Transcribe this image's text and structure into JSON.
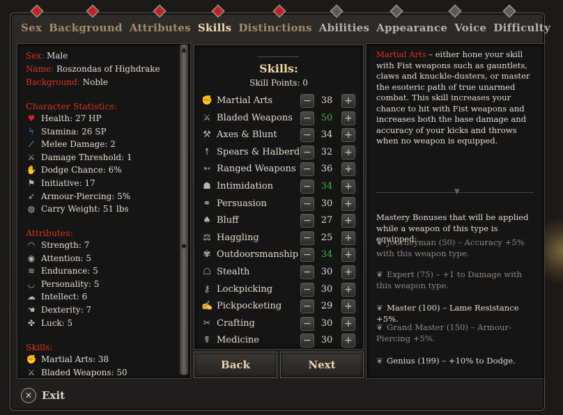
{
  "tabs": [
    {
      "label": "Sex",
      "state": "gold"
    },
    {
      "label": "Background",
      "state": "gold"
    },
    {
      "label": "Attributes",
      "state": "gold"
    },
    {
      "label": "Skills",
      "state": "active"
    },
    {
      "label": "Distinctions",
      "state": "gold"
    },
    {
      "label": "Abilities",
      "state": "grey"
    },
    {
      "label": "Appearance",
      "state": "grey"
    },
    {
      "label": "Voice",
      "state": "grey"
    },
    {
      "label": "Difficulty",
      "state": "grey"
    }
  ],
  "character": {
    "sex_label": "Sex:",
    "sex": "Male",
    "name_label": "Name:",
    "name": "Roszondas of Highdrake",
    "background_label": "Background:",
    "background": "Noble"
  },
  "statistics": {
    "heading": "Character Statistics:",
    "items": [
      {
        "icon": "heart-icon",
        "text": "Health: 27 HP"
      },
      {
        "icon": "bolt-icon",
        "text": "Stamina: 26 SP"
      },
      {
        "icon": "sword-icon",
        "text": "Melee Damage: 2"
      },
      {
        "icon": "slash-icon",
        "text": "Damage Threshold: 1"
      },
      {
        "icon": "dodge-icon",
        "text": "Dodge Chance: 6%"
      },
      {
        "icon": "flag-icon",
        "text": "Initiative: 17"
      },
      {
        "icon": "pierce-icon",
        "text": "Armour-Piercing: 5%"
      },
      {
        "icon": "weight-icon",
        "text": "Carry Weight: 51 lbs"
      }
    ]
  },
  "attributes": {
    "heading": "Attributes:",
    "items": [
      {
        "icon": "arm-icon",
        "text": "Strength: 7"
      },
      {
        "icon": "eye-icon",
        "text": "Attention: 5"
      },
      {
        "icon": "endurance-icon",
        "text": "Endurance: 5"
      },
      {
        "icon": "lips-icon",
        "text": "Personality: 5"
      },
      {
        "icon": "brain-icon",
        "text": "Intellect: 6"
      },
      {
        "icon": "hand-icon",
        "text": "Dexterity: 7"
      },
      {
        "icon": "clover-icon",
        "text": "Luck: 5"
      }
    ]
  },
  "skills_summary": {
    "heading": "Skills:",
    "items": [
      {
        "icon": "fist-icon",
        "text": "Martial Arts: 38"
      },
      {
        "icon": "blades-icon",
        "text": "Bladed Weapons: 50"
      }
    ]
  },
  "skills_panel": {
    "title": "Skills:",
    "points_label": "Skill Points: 0",
    "rows": [
      {
        "icon": "fist-icon",
        "name": "Martial Arts",
        "value": "38",
        "green": false
      },
      {
        "icon": "blades-icon",
        "name": "Bladed Weapons",
        "value": "50",
        "green": true
      },
      {
        "icon": "axe-icon",
        "name": "Axes & Blunt",
        "value": "34",
        "green": false
      },
      {
        "icon": "spear-icon",
        "name": "Spears & Halberds",
        "value": "32",
        "green": false
      },
      {
        "icon": "bow-icon",
        "name": "Ranged Weapons",
        "value": "36",
        "green": false
      },
      {
        "icon": "intimidation-icon",
        "name": "Intimidation",
        "value": "34",
        "green": true
      },
      {
        "icon": "handshake-icon",
        "name": "Persuasion",
        "value": "30",
        "green": false
      },
      {
        "icon": "bluff-icon",
        "name": "Bluff",
        "value": "27",
        "green": false
      },
      {
        "icon": "scales-icon",
        "name": "Haggling",
        "value": "25",
        "green": false
      },
      {
        "icon": "paw-icon",
        "name": "Outdoorsmanship",
        "value": "34",
        "green": true
      },
      {
        "icon": "hood-icon",
        "name": "Stealth",
        "value": "30",
        "green": false
      },
      {
        "icon": "lock-icon",
        "name": "Lockpicking",
        "value": "30",
        "green": false
      },
      {
        "icon": "pickpocket-icon",
        "name": "Pickpocketing",
        "value": "29",
        "green": false
      },
      {
        "icon": "tools-icon",
        "name": "Crafting",
        "value": "30",
        "green": false
      },
      {
        "icon": "medicine-icon",
        "name": "Medicine",
        "value": "30",
        "green": false
      }
    ],
    "minus": "−",
    "plus": "+"
  },
  "buttons": {
    "back": "Back",
    "next": "Next",
    "exit": "Exit",
    "exit_symbol": "✕"
  },
  "description": {
    "highlight": "Martial Arts",
    "text": " – either hone your skill with Fist weapons such as gauntlets, claws and knuckle-dusters, or master the esoteric path of true unarmed combat. This skill increases your chance to hit with Fist weapons and increases both the base damage and accuracy of your kicks and throws when no weapon is equipped.",
    "mastery_intro": "Mastery Bonuses that will be applied while a weapon of this type is equipped:",
    "mastery": [
      {
        "text": "Journeyman (50) – Accuracy +5% with this weapon type.",
        "dim": true
      },
      {
        "text": "Expert (75) – +1 to Damage with this weapon type.",
        "dim": true
      },
      {
        "text": "Master (100) – Lame Resistance +5%.",
        "dim": false
      },
      {
        "text": "Grand Master (150) – Armour-Piercing +5%.",
        "dim": true
      },
      {
        "text": "Genius (199) – +10% to Dodge.",
        "dim": false
      }
    ]
  },
  "colors": {
    "accent_red": "#d8341f",
    "gold": "#f2dcae",
    "green": "#45b04a"
  }
}
